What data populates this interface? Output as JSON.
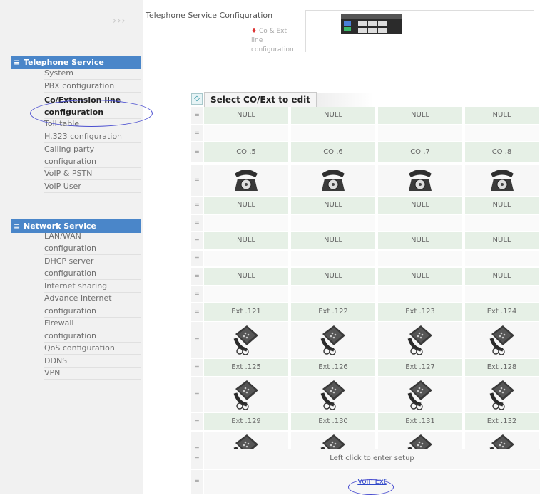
{
  "sidebar": {
    "chevrons": "›››",
    "sections": [
      {
        "label": "Telephone Service",
        "bullet": "≡"
      },
      {
        "label": "Network Service",
        "bullet": "≡"
      }
    ],
    "telephone_items": [
      {
        "label": "System"
      },
      {
        "label": "PBX configuration"
      },
      {
        "label": "Co/Extension line"
      },
      {
        "label": "configuration"
      },
      {
        "label": "Toll table"
      },
      {
        "label": "H.323 configuration"
      },
      {
        "label": "Calling party"
      },
      {
        "label": "configuration"
      },
      {
        "label": "VoIP & PSTN"
      },
      {
        "label": "VoIP User"
      }
    ],
    "network_items": [
      {
        "label": "LAN/WAN"
      },
      {
        "label": "configuration"
      },
      {
        "label": "DHCP server"
      },
      {
        "label": "configuration"
      },
      {
        "label": "Internet sharing"
      },
      {
        "label": "Advance Internet"
      },
      {
        "label": "configuration"
      },
      {
        "label": "Firewall"
      },
      {
        "label": "configuration"
      },
      {
        "label": "QoS configuration"
      },
      {
        "label": "DDNS"
      },
      {
        "label": "VPN"
      }
    ]
  },
  "header": {
    "title": "Telephone Service Configuration",
    "sub_line1": "Co & Ext",
    "sub_line2": "line",
    "sub_line3": "configuration"
  },
  "grid": {
    "corner_icon": "diamond-icon",
    "tab_label": "Select CO/Ext to edit",
    "row_marker": "=",
    "rows": [
      {
        "kind": "lab",
        "cells": [
          "NULL",
          "NULL",
          "NULL",
          "NULL"
        ]
      },
      {
        "kind": "blank"
      },
      {
        "kind": "lab",
        "cells": [
          "CO .5",
          "CO .6",
          "CO .7",
          "CO .8"
        ]
      },
      {
        "kind": "img",
        "icon": "rotary-phone"
      },
      {
        "kind": "lab",
        "cells": [
          "NULL",
          "NULL",
          "NULL",
          "NULL"
        ]
      },
      {
        "kind": "blank"
      },
      {
        "kind": "lab",
        "cells": [
          "NULL",
          "NULL",
          "NULL",
          "NULL"
        ]
      },
      {
        "kind": "blank"
      },
      {
        "kind": "lab",
        "cells": [
          "NULL",
          "NULL",
          "NULL",
          "NULL"
        ]
      },
      {
        "kind": "blank"
      },
      {
        "kind": "lab",
        "cells": [
          "Ext .121",
          "Ext .122",
          "Ext .123",
          "Ext .124"
        ]
      },
      {
        "kind": "img",
        "icon": "desk-phone"
      },
      {
        "kind": "lab",
        "cells": [
          "Ext .125",
          "Ext .126",
          "Ext .127",
          "Ext .128"
        ]
      },
      {
        "kind": "img",
        "icon": "desk-phone"
      },
      {
        "kind": "lab",
        "cells": [
          "Ext .129",
          "Ext .130",
          "Ext .131",
          "Ext .132"
        ]
      },
      {
        "kind": "img",
        "icon": "desk-phone"
      }
    ],
    "footer_text": "Left click to enter setup",
    "footer_link": "VoIP Ext"
  }
}
